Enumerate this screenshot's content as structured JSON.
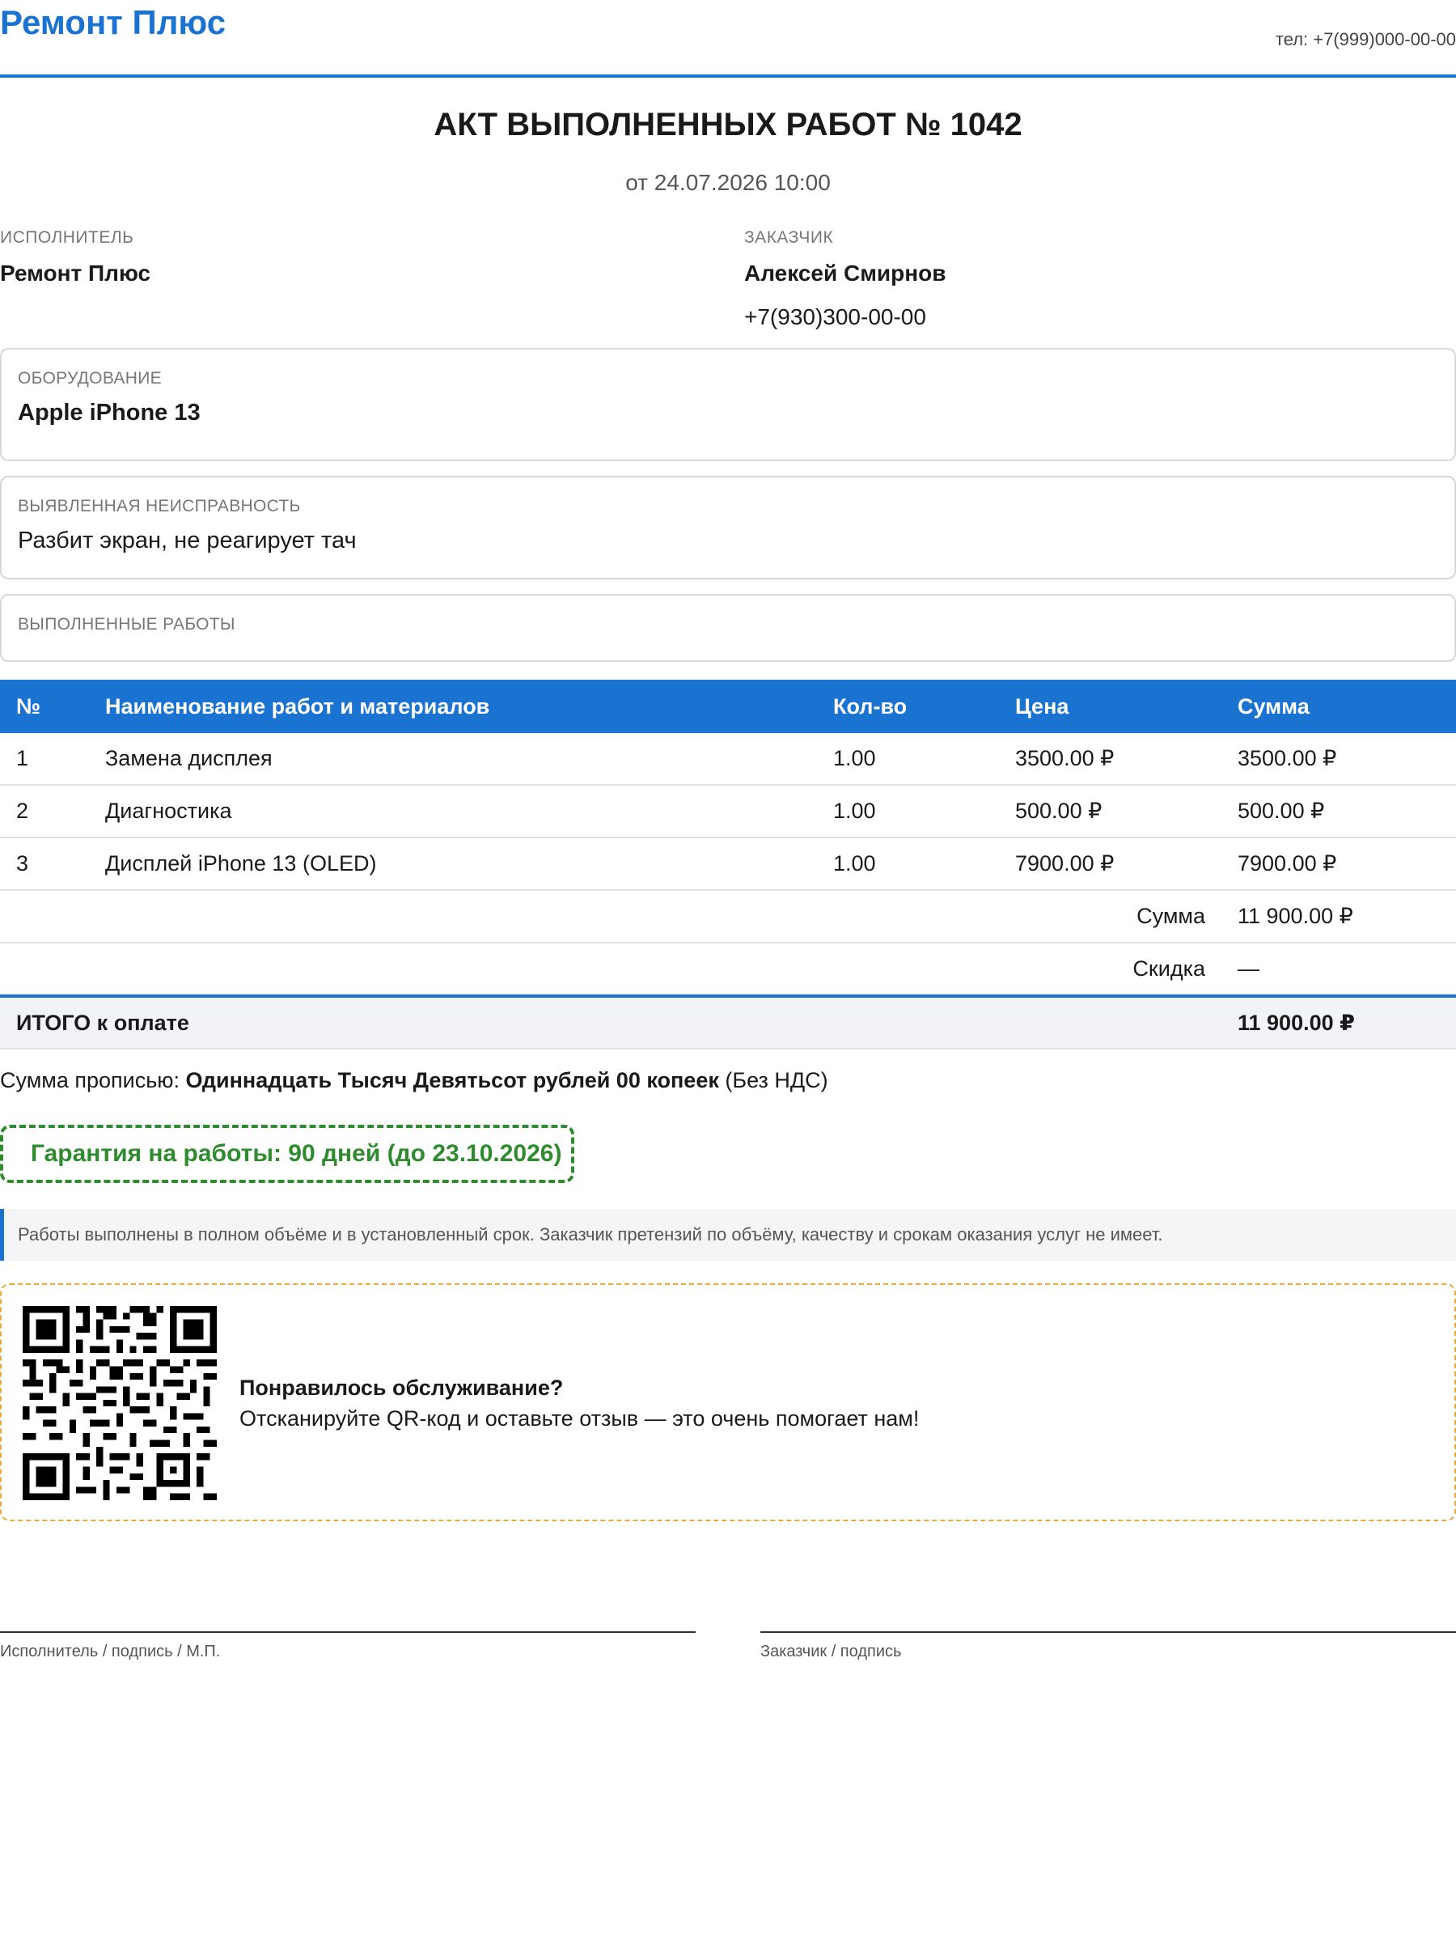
{
  "header": {
    "brand": "Ремонт Плюс",
    "phone": "тел: +7(999)000-00-00"
  },
  "document": {
    "title": "АКТ ВЫПОЛНЕННЫХ РАБОТ № 1042",
    "date": "от 24.07.2026 10:00"
  },
  "executor": {
    "label": "ИСПОЛНИТЕЛЬ",
    "name": "Ремонт Плюс"
  },
  "customer": {
    "label": "ЗАКАЗЧИК",
    "name": "Алексей Смирнов",
    "phone": "+7(930)300-00-00"
  },
  "equipment": {
    "label": "ОБОРУДОВАНИЕ",
    "value": "Apple iPhone 13"
  },
  "fault": {
    "label": "ВЫЯВЛЕННАЯ НЕИСПРАВНОСТЬ",
    "value": "Разбит экран, не реагирует тач"
  },
  "works": {
    "label": "ВЫПОЛНЕННЫЕ РАБОТЫ"
  },
  "table": {
    "headers": [
      "№",
      "Наименование работ и материалов",
      "Кол-во",
      "Цена",
      "Сумма"
    ],
    "rows": [
      [
        "1",
        "Замена дисплея",
        "1.00",
        "3500.00 ₽",
        "3500.00 ₽"
      ],
      [
        "2",
        "Диагностика",
        "1.00",
        "500.00 ₽",
        "500.00 ₽"
      ],
      [
        "3",
        "Дисплей iPhone 13 (OLED)",
        "1.00",
        "7900.00 ₽",
        "7900.00 ₽"
      ]
    ],
    "subtotal_label": "Сумма",
    "subtotal_value": "11 900.00 ₽",
    "discount_label": "Скидка",
    "discount_value": "—",
    "total_label": "ИТОГО к оплате",
    "total_value": "11 900.00 ₽"
  },
  "amount_words": {
    "prefix": "Сумма прописью:",
    "words": "Одиннадцать Тысяч Девятьсот рублей 00 копеек",
    "suffix": "(Без НДС)"
  },
  "guarantee": "Гарантия на работы: 90 дней (до 23.10.2026)",
  "note": "Работы выполнены в полном объёме и в установленный срок. Заказчик претензий по объёму, качеству и срокам оказания услуг не имеет.",
  "review": {
    "title": "Понравилось обслуживание?",
    "text": "Отсканируйте QR-код и оставьте отзыв — это очень помогает нам!"
  },
  "signatures": {
    "executor": "Исполнитель / подпись / М.П.",
    "customer": "Заказчик / подпись"
  },
  "colors": {
    "accent": "#1a73d0",
    "guarantee": "#2e8b2e",
    "review_border": "#e8a83a"
  }
}
